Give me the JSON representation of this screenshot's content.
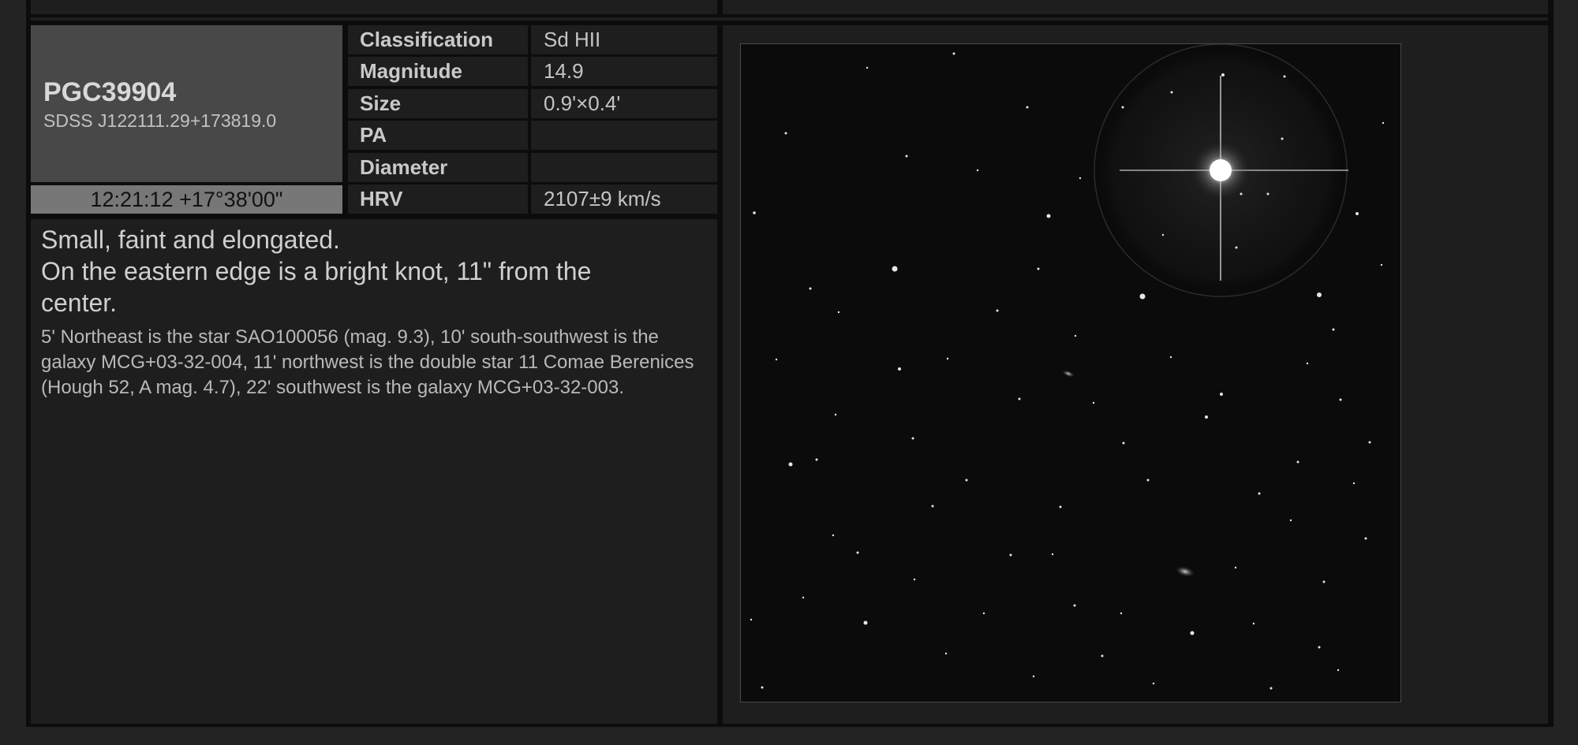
{
  "object": {
    "name": "PGC39904",
    "alt_name": "SDSS J122111.29+173819.0",
    "coordinates": "12:21:12 +17°38'00\""
  },
  "properties": [
    {
      "label": "Classification",
      "value": "Sd HII"
    },
    {
      "label": "Magnitude",
      "value": "14.9"
    },
    {
      "label": "Size",
      "value": "0.9'×0.4'"
    },
    {
      "label": "PA",
      "value": ""
    },
    {
      "label": "Diameter",
      "value": ""
    },
    {
      "label": "HRV",
      "value": "2107±9 km/s"
    }
  ],
  "description": {
    "lines": [
      "Small, faint and elongated.",
      "On the eastern edge is a bright knot, 11\" from the",
      "center."
    ],
    "notes": "5' Northeast is the star SAO100056 (mag. 9.3), 10' south-southwest is the galaxy MCG+03-32-004, 11' northwest is the double star 11 Comae Berenices (Hough 52, A mag. 4.7), 22' southwest is the galaxy MCG+03-32-003."
  }
}
